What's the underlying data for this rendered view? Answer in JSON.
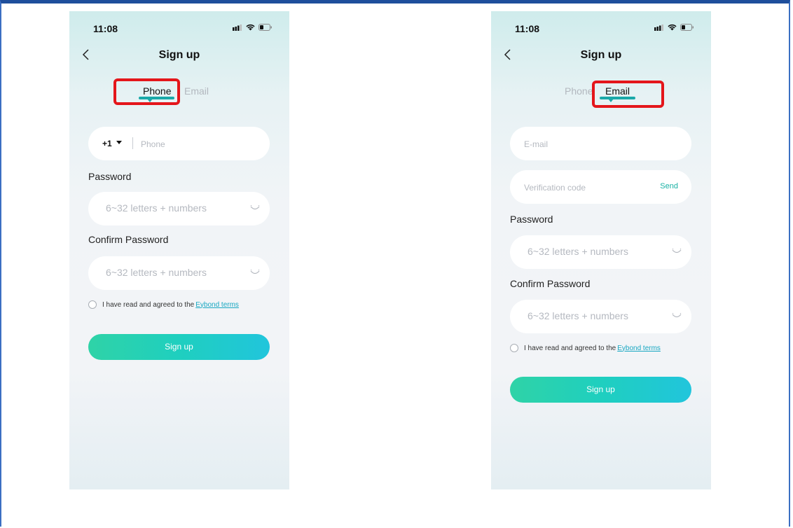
{
  "colors": {
    "accent": "#1aa9a9",
    "highlight": "#e4161b",
    "link": "#18a7c2",
    "send": "#19b1a4"
  },
  "left": {
    "status_time": "11:08",
    "title": "Sign up",
    "tabs": {
      "phone": "Phone",
      "email": "Email",
      "active": "phone"
    },
    "country_code": "+1",
    "phone_placeholder": "Phone",
    "password_label": "Password",
    "password_placeholder": "6~32 letters + numbers",
    "confirm_label": "Confirm Password",
    "confirm_placeholder": "6~32 letters + numbers",
    "agree_text": "I have read and agreed to the",
    "terms_link": "Eybond terms",
    "signup_button": "Sign up"
  },
  "right": {
    "status_time": "11:08",
    "title": "Sign up",
    "tabs": {
      "phone": "Phone",
      "email": "Email",
      "active": "email"
    },
    "email_placeholder": "E-mail",
    "code_placeholder": "Verification code",
    "send_label": "Send",
    "password_label": "Password",
    "password_placeholder": "6~32 letters + numbers",
    "confirm_label": "Confirm Password",
    "confirm_placeholder": "6~32 letters + numbers",
    "agree_text": "I have read and agreed to the",
    "terms_link": "Eybond terms",
    "signup_button": "Sign up"
  }
}
